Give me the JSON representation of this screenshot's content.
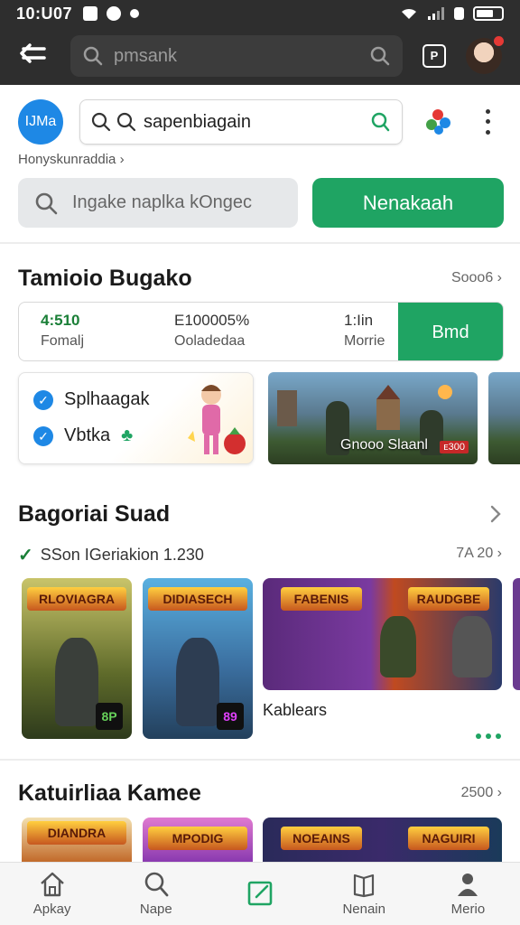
{
  "status_bar": {
    "time": "10:U07"
  },
  "top_bar": {
    "search_placeholder": "pmsank",
    "p_badge": "P"
  },
  "header": {
    "logo_text": "IJMa",
    "search_value": "sapenbiagain",
    "breadcrumb": "Honyskunraddia ›"
  },
  "action_row": {
    "search_placeholder": "Ingake naplka kOngec",
    "button_label": "Nenakaah"
  },
  "section1": {
    "title": "Tamioio Bugako",
    "more": "Sooo6 ›",
    "stats": [
      {
        "value": "4:510",
        "label": "Fomalj"
      },
      {
        "value": "E100005%",
        "label": "Ooladedaa"
      },
      {
        "value": "1:Iin",
        "label": "Morrie"
      }
    ],
    "stats_button": "Bmd",
    "promo": {
      "line1": "Splhaagak",
      "line2": "Vbtka"
    },
    "banner_caption": "Gnooo Slaanl",
    "banner_tag": "ᴇ300"
  },
  "section2": {
    "title": "Bagoriai Suad",
    "meta_left": "SSon IGeriakion 1.230",
    "meta_right": "7A 20 ›",
    "covers": [
      {
        "title": "RLOVIAGRA",
        "rating": "8P"
      },
      {
        "title": "DIDIASECH",
        "rating": "89"
      },
      {
        "title": "FABENIS"
      },
      {
        "title": "RAUDGBE"
      }
    ],
    "caption": "Kablears"
  },
  "section3": {
    "title": "Katuirliaa Kamee",
    "more": "2500 ›",
    "covers": [
      {
        "title": "DIANDRA"
      },
      {
        "title": "MPODIG"
      },
      {
        "title": "NOEAINS"
      },
      {
        "title": "NAGUIRI"
      }
    ]
  },
  "bottom_nav": [
    {
      "label": "Apkay",
      "icon": "home-icon"
    },
    {
      "label": "Nape",
      "icon": "search-icon"
    },
    {
      "label": "",
      "icon": "edit-icon"
    },
    {
      "label": "Nenain",
      "icon": "book-icon"
    },
    {
      "label": "Merio",
      "icon": "person-icon"
    }
  ],
  "colors": {
    "accent": "#1fa463",
    "dark_bar": "#2e2e2e",
    "brand_blue": "#1e88e5"
  }
}
